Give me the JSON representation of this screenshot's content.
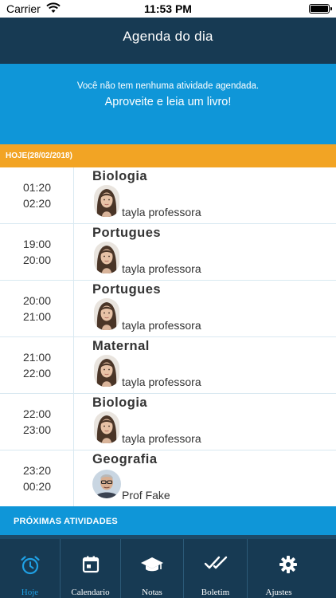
{
  "status_bar": {
    "carrier": "Carrier",
    "time": "11:53 PM"
  },
  "header": {
    "title": "Agenda do dia"
  },
  "banner": {
    "line1": "Você não tem nenhuma atividade agendada.",
    "line2": "Aproveite e leia um livro!"
  },
  "date_bar": {
    "label": "HOJE(28/02/2018)"
  },
  "events": [
    {
      "start": "01:20",
      "end": "02:20",
      "subject": "Biologia",
      "teacher": "tayla professora",
      "avatar": "female-avatar"
    },
    {
      "start": "19:00",
      "end": "20:00",
      "subject": "Portugues",
      "teacher": "tayla professora",
      "avatar": "female-avatar"
    },
    {
      "start": "20:00",
      "end": "21:00",
      "subject": "Portugues",
      "teacher": "tayla professora",
      "avatar": "female-avatar"
    },
    {
      "start": "21:00",
      "end": "22:00",
      "subject": "Maternal",
      "teacher": "tayla professora",
      "avatar": "female-avatar"
    },
    {
      "start": "22:00",
      "end": "23:00",
      "subject": "Biologia",
      "teacher": "tayla professora",
      "avatar": "female-avatar"
    },
    {
      "start": "23:20",
      "end": "00:20",
      "subject": "Geografia",
      "teacher": "Prof Fake",
      "avatar": "male-avatar"
    }
  ],
  "upcoming": {
    "label": "PRÓXIMAS ATIVIDADES"
  },
  "tabs": [
    {
      "label": "Hoje",
      "icon": "alarm-clock-icon",
      "active": true
    },
    {
      "label": "Calendario",
      "icon": "calendar-icon",
      "active": false
    },
    {
      "label": "Notas",
      "icon": "graduation-cap-icon",
      "active": false
    },
    {
      "label": "Boletim",
      "icon": "double-check-icon",
      "active": false
    },
    {
      "label": "Ajustes",
      "icon": "gear-icon",
      "active": false
    }
  ],
  "colors": {
    "header": "#173a53",
    "banner": "#0f96d8",
    "date_bar": "#f2a424",
    "tab_active": "#1fa0e4"
  }
}
